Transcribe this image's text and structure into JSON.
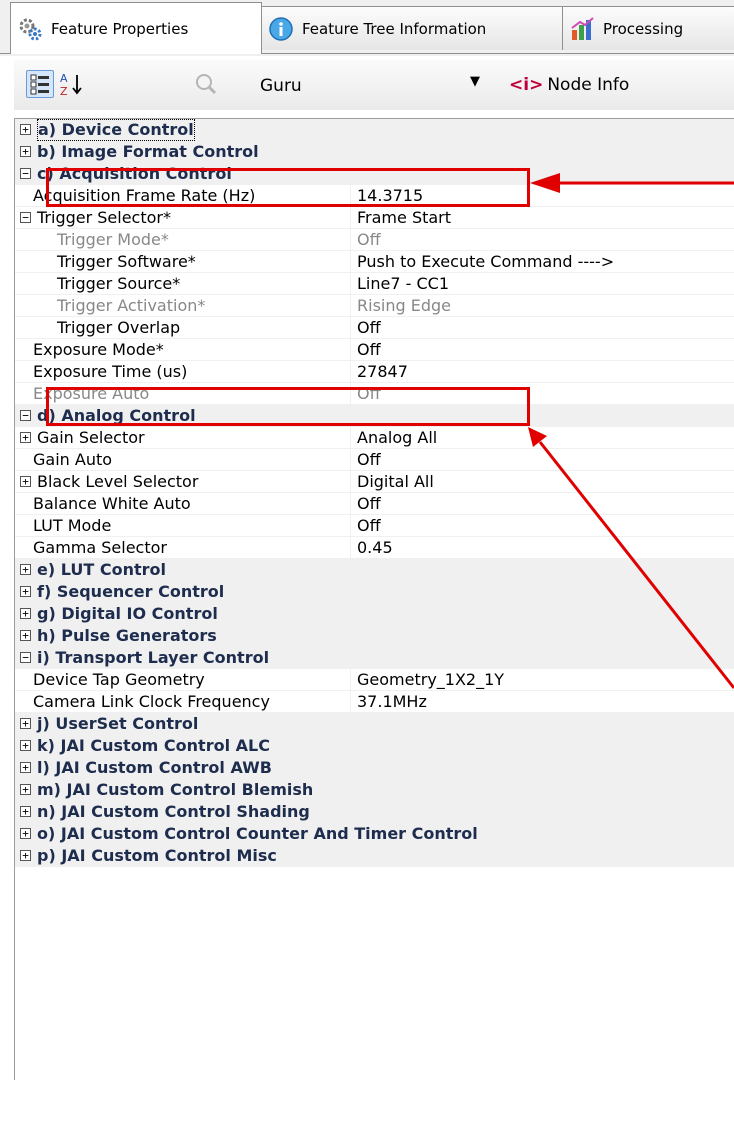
{
  "tabs": [
    {
      "label": "Feature Properties",
      "icon": "gears-icon",
      "active": true
    },
    {
      "label": "Feature Tree Information",
      "icon": "info-icon",
      "active": false
    },
    {
      "label": "Processing",
      "icon": "chart-icon",
      "active": false
    }
  ],
  "toolbar": {
    "visibility": "Guru",
    "node_info_tag": "<i>",
    "node_info_label": "Node Info"
  },
  "rows": [
    {
      "type": "cat",
      "exp": "+",
      "name": "a) Device Control",
      "focus": true
    },
    {
      "type": "cat",
      "exp": "+",
      "name": "b) Image Format Control"
    },
    {
      "type": "cat",
      "exp": "−",
      "name": "c) Acquisition Control"
    },
    {
      "type": "item",
      "name": "Acquisition Frame Rate (Hz)",
      "value": "14.3715",
      "indent": 0
    },
    {
      "type": "item",
      "exp": "−",
      "name": "Trigger Selector*",
      "value": "Frame Start",
      "indent": 0
    },
    {
      "type": "item",
      "name": "Trigger Mode*",
      "value": "Off",
      "indent": 1,
      "dim": true
    },
    {
      "type": "item",
      "name": "Trigger Software*",
      "value": "Push to Execute Command ---->",
      "indent": 1
    },
    {
      "type": "item",
      "name": "Trigger Source*",
      "value": "Line7 - CC1",
      "indent": 1
    },
    {
      "type": "item",
      "name": "Trigger Activation*",
      "value": "Rising Edge",
      "indent": 1,
      "dim": true
    },
    {
      "type": "item",
      "name": "Trigger Overlap",
      "value": "Off",
      "indent": 1
    },
    {
      "type": "item",
      "name": "Exposure Mode*",
      "value": "Off",
      "indent": 0
    },
    {
      "type": "item",
      "name": "Exposure Time (us)",
      "value": "27847",
      "indent": 0
    },
    {
      "type": "item",
      "name": "Exposure Auto",
      "value": "Off",
      "indent": 0,
      "dim": true
    },
    {
      "type": "cat",
      "exp": "−",
      "name": "d) Analog Control"
    },
    {
      "type": "item",
      "exp": "+",
      "name": "Gain Selector",
      "value": "Analog All",
      "indent": 0
    },
    {
      "type": "item",
      "name": "Gain Auto",
      "value": "Off",
      "indent": 0
    },
    {
      "type": "item",
      "exp": "+",
      "name": "Black Level Selector",
      "value": "Digital All",
      "indent": 0
    },
    {
      "type": "item",
      "name": "Balance White Auto",
      "value": "Off",
      "indent": 0
    },
    {
      "type": "item",
      "name": "LUT Mode",
      "value": "Off",
      "indent": 0
    },
    {
      "type": "item",
      "name": "Gamma Selector",
      "value": "0.45",
      "indent": 0
    },
    {
      "type": "cat",
      "exp": "+",
      "name": "e) LUT Control"
    },
    {
      "type": "cat",
      "exp": "+",
      "name": "f) Sequencer Control"
    },
    {
      "type": "cat",
      "exp": "+",
      "name": "g) Digital IO Control"
    },
    {
      "type": "cat",
      "exp": "+",
      "name": "h) Pulse Generators"
    },
    {
      "type": "cat",
      "exp": "−",
      "name": "i) Transport Layer Control"
    },
    {
      "type": "item",
      "name": "Device Tap Geometry",
      "value": "Geometry_1X2_1Y",
      "indent": 0
    },
    {
      "type": "item",
      "name": "Camera Link Clock Frequency",
      "value": "37.1MHz",
      "indent": 0
    },
    {
      "type": "cat",
      "exp": "+",
      "name": "j) UserSet Control"
    },
    {
      "type": "cat",
      "exp": "+",
      "name": "k) JAI Custom Control ALC"
    },
    {
      "type": "cat",
      "exp": "+",
      "name": "l) JAI Custom Control AWB"
    },
    {
      "type": "cat",
      "exp": "+",
      "name": "m) JAI Custom Control Blemish"
    },
    {
      "type": "cat",
      "exp": "+",
      "name": "n) JAI Custom Control Shading"
    },
    {
      "type": "cat",
      "exp": "+",
      "name": "o) JAI Custom Control Counter And Timer Control"
    },
    {
      "type": "cat",
      "exp": "+",
      "name": "p) JAI Custom Control Misc"
    }
  ],
  "annotation_color": "#e00000"
}
